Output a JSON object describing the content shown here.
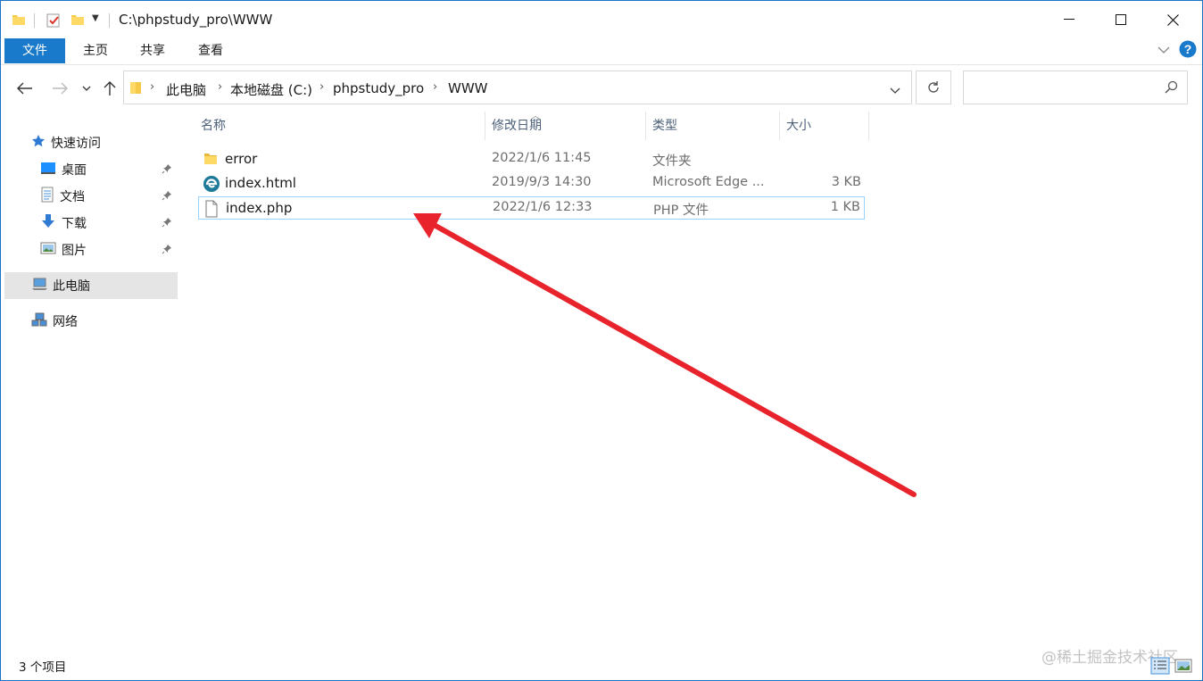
{
  "window": {
    "title": "C:\\phpstudy_pro\\WWW"
  },
  "ribbon": {
    "tabs": [
      "文件",
      "主页",
      "共享",
      "查看"
    ]
  },
  "address": {
    "crumbs": [
      "此电脑",
      "本地磁盘 (C:)",
      "phpstudy_pro",
      "WWW"
    ],
    "search_placeholder": ""
  },
  "sidebar": {
    "quick_access": "快速访问",
    "items": [
      {
        "label": "桌面",
        "icon": "desktop-icon",
        "pinned": true
      },
      {
        "label": "文档",
        "icon": "documents-icon",
        "pinned": true
      },
      {
        "label": "下载",
        "icon": "downloads-icon",
        "pinned": true
      },
      {
        "label": "图片",
        "icon": "pictures-icon",
        "pinned": true
      }
    ],
    "this_pc": "此电脑",
    "network": "网络"
  },
  "columns": {
    "name": "名称",
    "date": "修改日期",
    "type": "类型",
    "size": "大小"
  },
  "files": [
    {
      "name": "error",
      "date": "2022/1/6 11:45",
      "type": "文件夹",
      "size": "",
      "icon": "folder-icon"
    },
    {
      "name": "index.html",
      "date": "2019/9/3 14:30",
      "type": "Microsoft Edge ...",
      "size": "3 KB",
      "icon": "edge-icon"
    },
    {
      "name": "index.php",
      "date": "2022/1/6 12:33",
      "type": "PHP 文件",
      "size": "1 KB",
      "icon": "file-icon",
      "selected": true
    }
  ],
  "status": {
    "count": "3 个项目"
  },
  "watermark": "@稀土掘金技术社区",
  "colors": {
    "accent": "#1979ca",
    "arrow": "#e8232b",
    "selection_border": "#99d1ff"
  }
}
